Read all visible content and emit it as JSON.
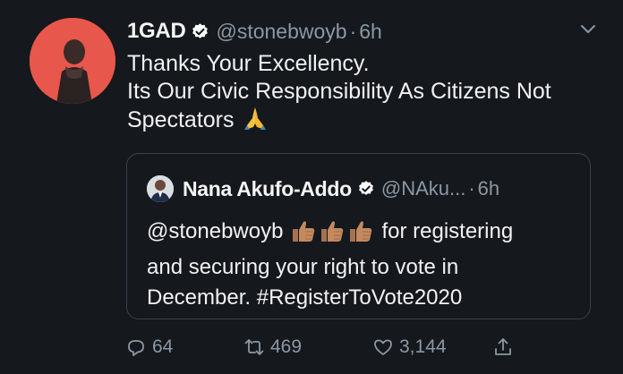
{
  "tweet": {
    "author": {
      "display_name": "1GAD",
      "handle": "@stonebwoyb",
      "separator": "·",
      "time": "6h",
      "verified": true,
      "avatar_color": "#e8574b"
    },
    "body": {
      "line1": "Thanks Your Excellency.",
      "line2": "Its Our Civic Responsibility As Citizens Not",
      "line3": "Spectators",
      "emoji": "folded-hands-icon"
    },
    "quote": {
      "display_name": "Nana Akufo-Addo",
      "handle": "@NAku...",
      "separator": "·",
      "time": "6h",
      "verified": true,
      "text_line1_mention": "@stonebwoyb",
      "text_line1_rest": "for registering",
      "text_line2": "and securing your right to vote in",
      "text_line3": "December. #RegisterToVote2020",
      "emoji": "thumbs-up-icon",
      "emoji_count": 3
    },
    "actions": {
      "reply_count": "64",
      "retweet_count": "469",
      "like_count": "3,144"
    }
  },
  "colors": {
    "background": "#15181c",
    "text": "#e7e9ea",
    "muted": "#8b98a5",
    "border": "#38444d",
    "verified_badge": "#ffffff"
  }
}
